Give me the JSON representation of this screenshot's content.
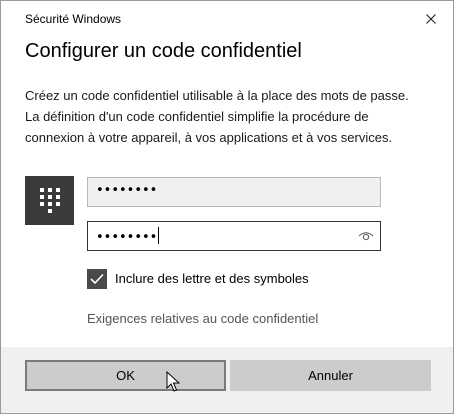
{
  "window": {
    "app_title": "Sécurité Windows",
    "close_icon": "close-icon"
  },
  "dialog": {
    "heading": "Configurer un code confidentiel",
    "description": "Créez un code confidentiel utilisable à la place des mots de passe. La définition d'un code confidentiel simplifie la procédure de connexion à votre appareil, à vos applications et à vos services."
  },
  "pin_tile": {
    "icon": "keypad-icon",
    "color": "#3a3a3a"
  },
  "fields": {
    "new_pin": {
      "masked_value": "••••••••"
    },
    "confirm_pin": {
      "masked_value": "••••••••",
      "reveal_icon": "eye-icon"
    }
  },
  "options": {
    "include_letters_label": "Inclure des lettre et des symboles",
    "include_letters_checked": true
  },
  "links": {
    "requirements": "Exigences relatives au code confidentiel"
  },
  "buttons": {
    "ok": "OK",
    "cancel": "Annuler"
  }
}
